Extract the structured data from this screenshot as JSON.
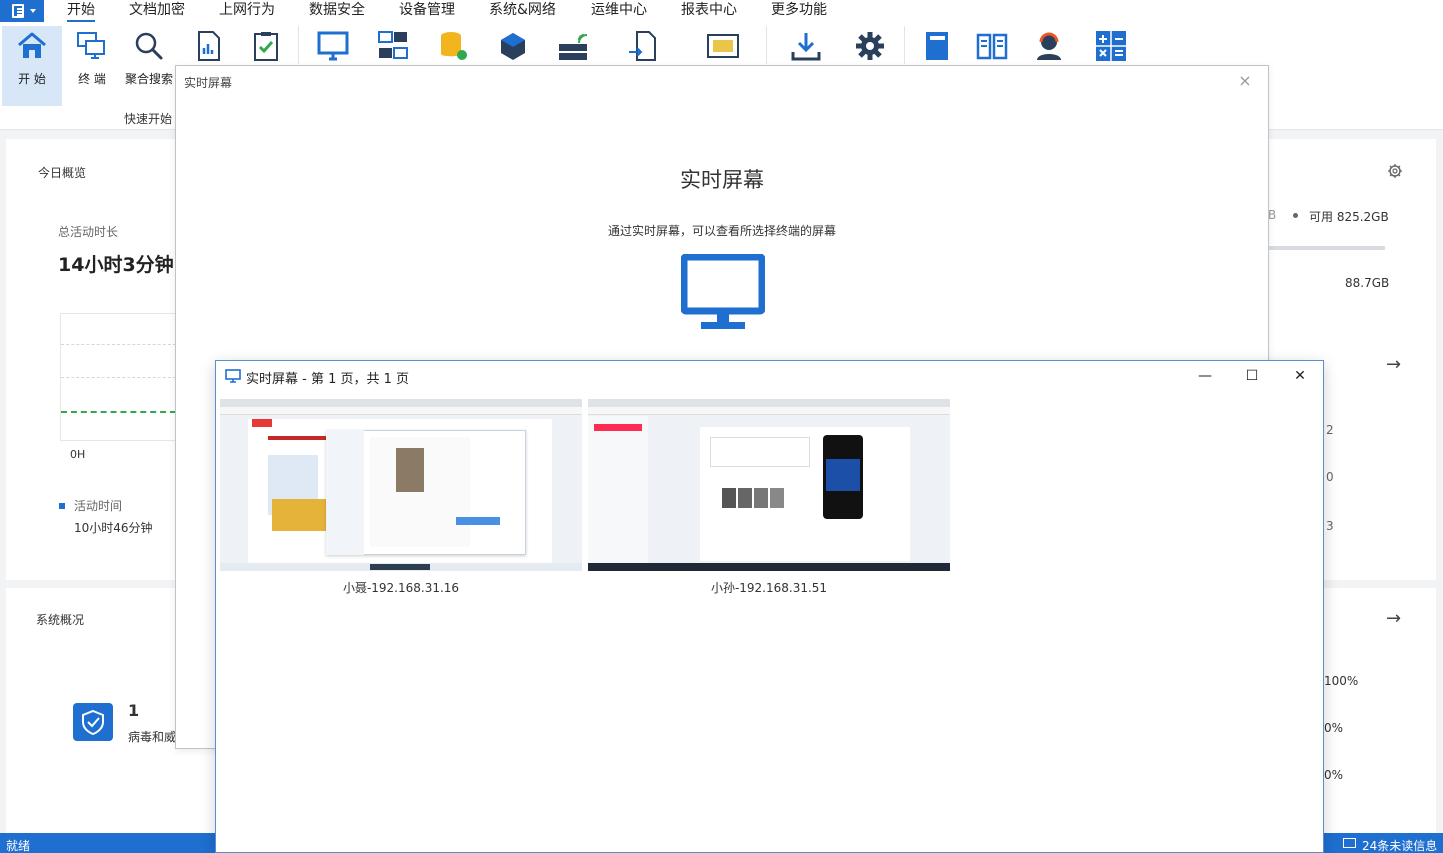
{
  "menubar": {
    "tabs": [
      "开始",
      "文档加密",
      "上网行为",
      "数据安全",
      "设备管理",
      "系统&网络",
      "运维中心",
      "报表中心",
      "更多功能"
    ],
    "active_tab": "开始"
  },
  "ribbon": {
    "buttons": [
      {
        "label": "开 始",
        "icon": "home-icon"
      },
      {
        "label": "终 端",
        "icon": "terminals-icon"
      },
      {
        "label": "聚合搜索",
        "icon": "search-icon"
      }
    ],
    "icons": [
      "report-doc-icon",
      "checklist-icon",
      "monitor-icon",
      "network-screens-icon",
      "database-icon",
      "cube-icon",
      "wireless-server-icon",
      "document-transfer-icon",
      "network-card-icon",
      "download-icon",
      "settings-gear-icon",
      "book-icon",
      "open-book-icon",
      "support-agent-icon",
      "calculator-icon"
    ],
    "group_label": "快速开始"
  },
  "dashboard": {
    "today_title": "今日概览",
    "total_active_label": "总活动时长",
    "total_active_value": "14小时3分钟",
    "chart_axis_label": "0H",
    "legend_active_label": "活动时间",
    "legend_active_value": "10小时46分钟",
    "disk_fragment_left": "B",
    "disk_available": "可用 825.2GB",
    "disk_used": "88.7GB",
    "right_fragments": [
      "2",
      "0",
      "3"
    ],
    "system_title": "系统概况",
    "virus_count": "1",
    "virus_label": "病毒和威",
    "percent_fragments": [
      "100%",
      "0%",
      "0%"
    ]
  },
  "dialog_realtime": {
    "title": "实时屏幕",
    "heading": "实时屏幕",
    "description": "通过实时屏幕，可以查看所选择终端的屏幕",
    "close": "×"
  },
  "window_screens": {
    "title": "实时屏幕 - 第 1 页，共 1 页",
    "minimize": "—",
    "maximize": "☐",
    "close": "✕",
    "screens": [
      {
        "caption": "小聂-192.168.31.16"
      },
      {
        "caption": "小孙-192.168.31.51"
      }
    ]
  },
  "statusbar": {
    "status": "就绪",
    "unread": "24条未读信息"
  },
  "colors": {
    "accent": "#1e6fd0",
    "ribbon_active": "#d7e7f7",
    "chart_green": "#2fa84f"
  }
}
